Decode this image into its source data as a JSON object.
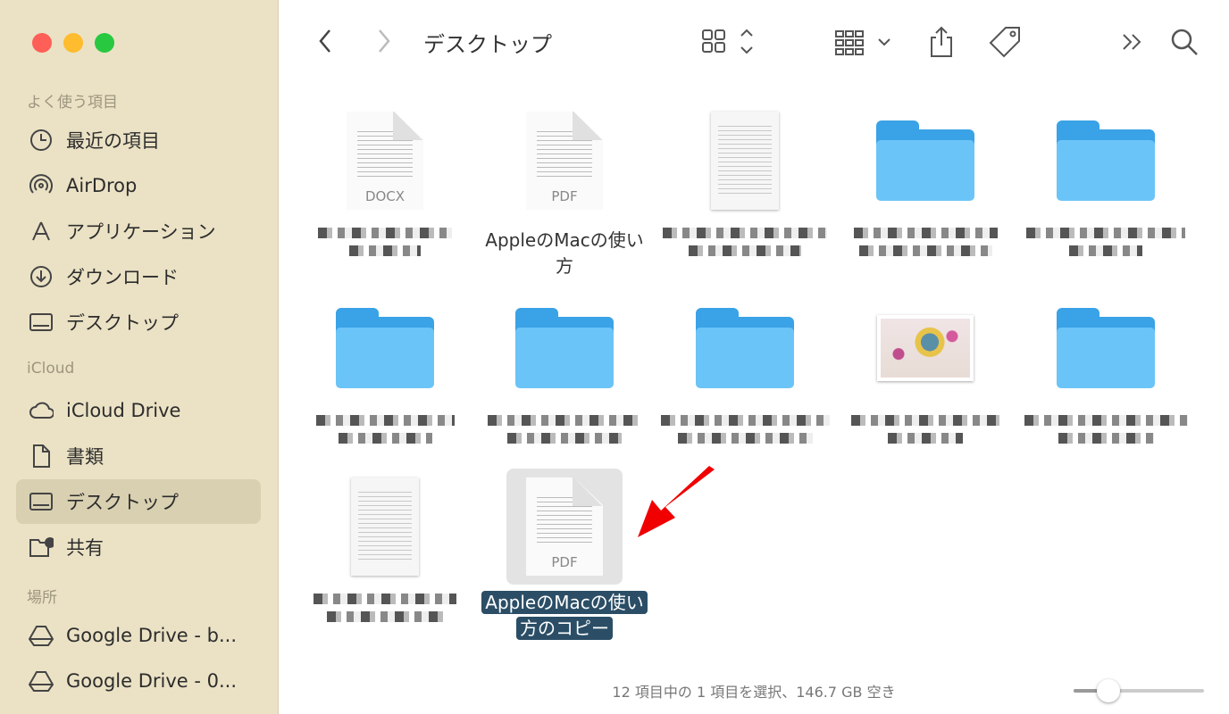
{
  "window": {
    "title": "デスクトップ",
    "colors": {
      "close": "#fe5f57",
      "minimize": "#febc2e",
      "zoom": "#28c840",
      "selection": "#2b4e66",
      "folder": "#6bc4f7",
      "arrow": "#f00000"
    }
  },
  "sidebar": {
    "sections": [
      {
        "title": "よく使う項目",
        "items": [
          {
            "label": "最近の項目",
            "icon": "clock-icon"
          },
          {
            "label": "AirDrop",
            "icon": "airdrop-icon"
          },
          {
            "label": "アプリケーション",
            "icon": "applications-icon"
          },
          {
            "label": "ダウンロード",
            "icon": "download-icon"
          },
          {
            "label": "デスクトップ",
            "icon": "desktop-icon"
          }
        ]
      },
      {
        "title": "iCloud",
        "items": [
          {
            "label": "iCloud Drive",
            "icon": "cloud-icon"
          },
          {
            "label": "書類",
            "icon": "document-icon"
          },
          {
            "label": "デスクトップ",
            "icon": "desktop-icon",
            "selected": true
          },
          {
            "label": "共有",
            "icon": "shared-folder-icon"
          }
        ]
      },
      {
        "title": "場所",
        "items": [
          {
            "label": "Google Drive - b...",
            "icon": "drive-icon"
          },
          {
            "label": "Google Drive - 0...",
            "icon": "drive-icon"
          }
        ]
      }
    ]
  },
  "toolbar": {
    "back": "chevron-left-icon",
    "forward": "chevron-right-icon",
    "view": "grid-view-icon",
    "group": "group-icon",
    "share": "share-icon",
    "tag": "tag-icon",
    "more": "more-icon",
    "search": "search-icon"
  },
  "files": [
    {
      "kind": "doc",
      "ext": "DOCX",
      "label": ""
    },
    {
      "kind": "doc",
      "ext": "PDF",
      "label": "AppleのMacの使い方"
    },
    {
      "kind": "page",
      "label": ""
    },
    {
      "kind": "folder",
      "label": ""
    },
    {
      "kind": "folder",
      "label": ""
    },
    {
      "kind": "folder",
      "label": ""
    },
    {
      "kind": "folder",
      "label": ""
    },
    {
      "kind": "folder",
      "label": ""
    },
    {
      "kind": "photo",
      "label": ""
    },
    {
      "kind": "folder",
      "label": ""
    },
    {
      "kind": "page",
      "label": ""
    },
    {
      "kind": "doc",
      "ext": "PDF",
      "label": "AppleのMacの使い方のコピー",
      "selected": true
    }
  ],
  "status": "12 項目中の 1 項目を選択、146.7 GB 空き",
  "icon_size": 0.25
}
